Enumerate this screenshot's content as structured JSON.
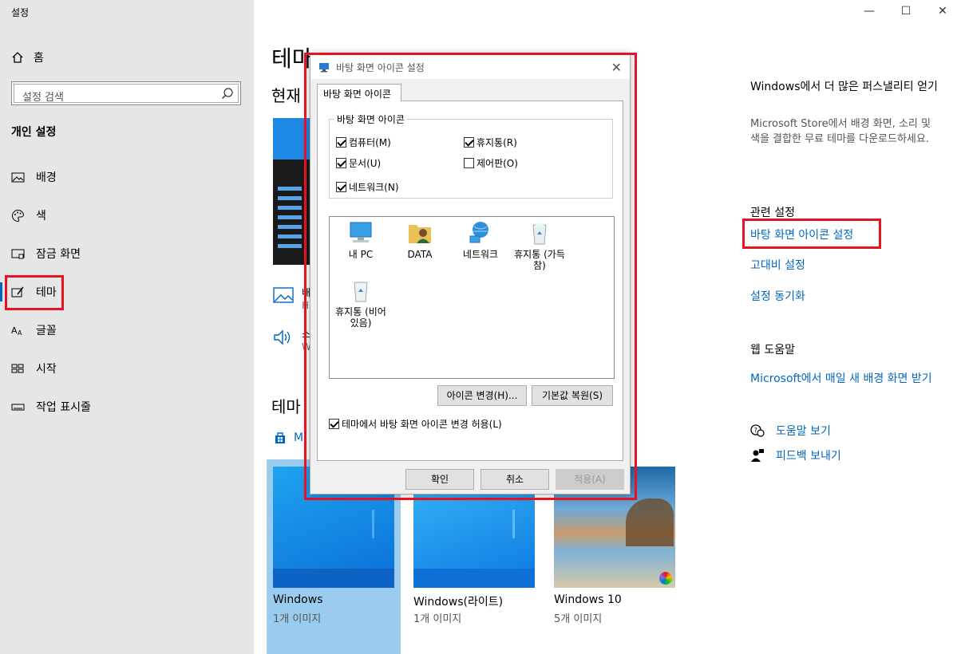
{
  "window": {
    "title": "설정",
    "minimize": "—",
    "maximize": "☐",
    "close": "✕"
  },
  "sidebar": {
    "home_label": "홈",
    "search_placeholder": "설정 검색",
    "section_title": "개인 설정",
    "items": [
      {
        "label": "배경",
        "icon": "picture-icon"
      },
      {
        "label": "색",
        "icon": "palette-icon"
      },
      {
        "label": "잠금 화면",
        "icon": "lock-screen-icon"
      },
      {
        "label": "테마",
        "icon": "theme-brush-icon",
        "active": true
      },
      {
        "label": "글꼴",
        "icon": "font-icon"
      },
      {
        "label": "시작",
        "icon": "start-icon"
      },
      {
        "label": "작업 표시줄",
        "icon": "taskbar-icon"
      }
    ]
  },
  "main": {
    "title": "테마",
    "current_theme_heading": "현재",
    "row1_char": "배",
    "row1_sub": "H",
    "row2_char": "소",
    "row2_sub": "W",
    "themes_heading": "테마",
    "store_link": "Mi",
    "themes": [
      {
        "name": "Windows",
        "count": "1개 이미지"
      },
      {
        "name": "Windows(라이트)",
        "count": "1개 이미지"
      },
      {
        "name": "Windows 10",
        "count": "5개 이미지"
      }
    ]
  },
  "right": {
    "personal_title": "Windows에서 더 많은 퍼스낼리티 얻기",
    "personal_desc": "Microsoft Store에서 배경 화면, 소리 및 색을 결합한 무료 테마를 다운로드하세요.",
    "related_heading": "관련 설정",
    "links": [
      "바탕 화면 아이콘 설정",
      "고대비 설정",
      "설정 동기화"
    ],
    "web_help_heading": "웹 도움말",
    "web_help_link": "Microsoft에서 매일 새 배경 화면 받기",
    "help_link": "도움말 보기",
    "feedback_link": "피드백 보내기"
  },
  "dialog": {
    "title": "바탕 화면 아이콘 설정",
    "tab": "바탕 화면 아이콘",
    "group_label": "바탕 화면 아이콘",
    "checkboxes": [
      {
        "label": "컴퓨터(M)",
        "checked": true
      },
      {
        "label": "휴지통(R)",
        "checked": true
      },
      {
        "label": "문서(U)",
        "checked": true
      },
      {
        "label": "제어판(O)",
        "checked": false
      },
      {
        "label": "네트워크(N)",
        "checked": true
      }
    ],
    "icons": [
      {
        "label": "내 PC",
        "icon": "pc-icon"
      },
      {
        "label": "DATA",
        "icon": "user-folder-icon"
      },
      {
        "label": "네트워크",
        "icon": "network-icon"
      },
      {
        "label": "휴지통 (가득 참)",
        "icon": "recycle-full-icon"
      },
      {
        "label": "휴지통 (비어 있음)",
        "icon": "recycle-empty-icon"
      }
    ],
    "change_icon_button": "아이콘 변경(H)...",
    "restore_default_button": "기본값 복원(S)",
    "allow_theme_checkbox": "테마에서 바탕 화면 아이콘 변경 허용(L)",
    "allow_theme_checked": true,
    "ok_button": "확인",
    "cancel_button": "취소",
    "apply_button": "적용(A)"
  },
  "colors": {
    "accent": "#0067c0",
    "highlight_border": "#e81123",
    "sidebar_bg": "#e6e6e6"
  }
}
